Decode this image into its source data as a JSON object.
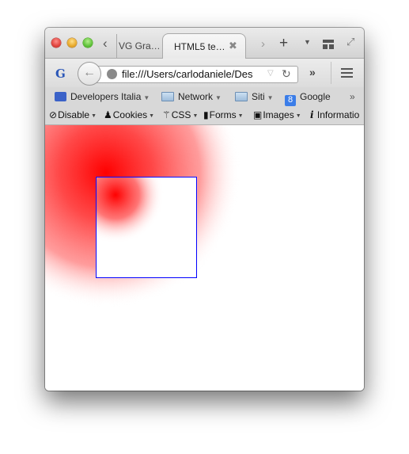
{
  "window": {
    "controls": [
      "close",
      "minimize",
      "zoom"
    ]
  },
  "tabs": {
    "inactive_label": "VG Gra…",
    "active_label": "HTML5 te…",
    "close_glyph": "✖",
    "back_glyph": "‹",
    "forward_glyph": "›",
    "new_tab_glyph": "+",
    "list_glyph": "▼",
    "fullscreen_glyph": "⤢"
  },
  "navbar": {
    "logo_glyph": "G",
    "back_glyph": "←",
    "url": "file:///Users/carlodaniele/Des",
    "dropdown_glyph": "▽",
    "reload_glyph": "↻",
    "overflow_glyph": "»"
  },
  "bookmarks": {
    "items": [
      {
        "label": "Developers Italia",
        "icon": "rss-folder-icon",
        "has_menu": true
      },
      {
        "label": "Network",
        "icon": "folder-icon",
        "has_menu": true
      },
      {
        "label": "Siti",
        "icon": "folder-icon",
        "has_menu": true
      },
      {
        "label": "Google",
        "icon": "google-icon",
        "has_menu": false
      }
    ],
    "caret": "▼",
    "google_glyph": "8",
    "overflow_glyph": "»"
  },
  "devtoolbar": {
    "items": [
      {
        "label": "Disable",
        "glyph": "⃠"
      },
      {
        "label": "Cookies",
        "glyph": "👤"
      },
      {
        "label": "CSS",
        "glyph": "✨"
      },
      {
        "label": "Forms",
        "glyph": "📋"
      },
      {
        "label": "Images",
        "glyph": "🖼"
      },
      {
        "label": "Informatio",
        "glyph": "ℹ"
      }
    ],
    "caret": "▼"
  },
  "canvas": {
    "gradient_color": "#ff0000",
    "rect_stroke_color": "#0000ff"
  }
}
